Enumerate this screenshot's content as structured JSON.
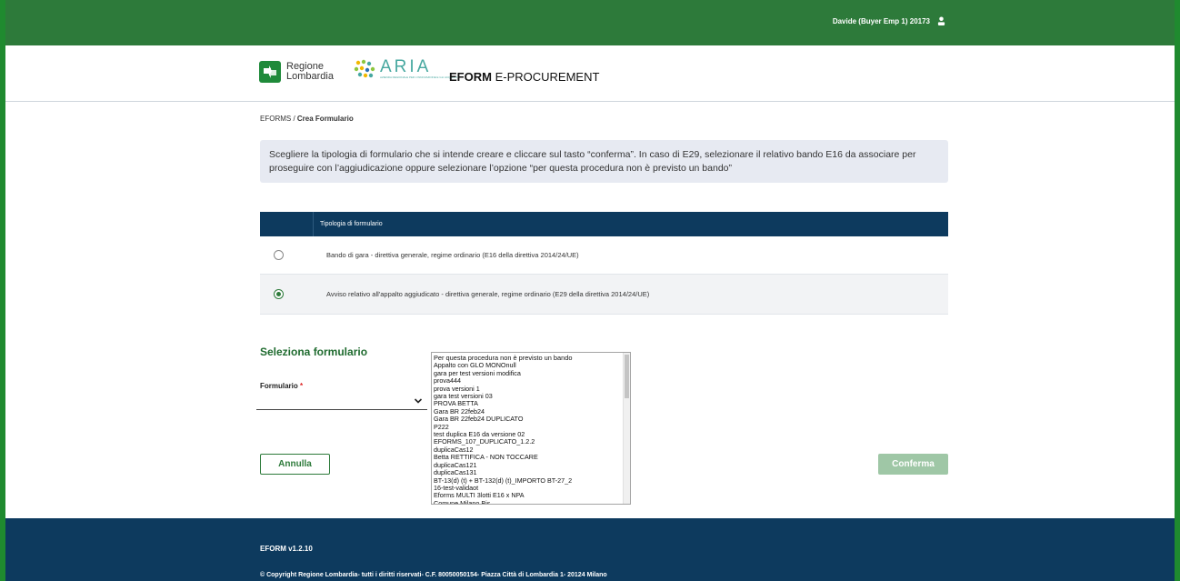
{
  "topbar": {
    "user_label": "Davide (Buyer Emp 1) 20173"
  },
  "header": {
    "rl_line1": "Regione",
    "rl_line2": "Lombardia",
    "aria_text": "ARIA",
    "aria_sub": "AZIENDA REGIONALE PER L'INNOVAZIONE E GLI ACQUISTI",
    "title_bold": "EFORM",
    "title_rest": " E-PROCUREMENT"
  },
  "breadcrumb": {
    "root": "EFORMS",
    "separator": " / ",
    "current": "Crea Formulario"
  },
  "info_text": "Scegliere la tipologia di formulario che si intende creare e cliccare sul tasto “conferma”. In caso di E29, selezionare il relativo bando E16 da associare per proseguire con l’aggiudicazione oppure selezionare l’opzione “per questa procedura non è previsto un bando”",
  "table": {
    "header": "Tipologia di formulario",
    "rows": [
      {
        "label": "Bando di gara - direttiva generale, regime ordinario (E16 della direttiva 2014/24/UE)",
        "selected": false
      },
      {
        "label": "Avviso relativo all'appalto aggiudicato - direttiva generale, regime ordinario (E29 della direttiva 2014/24/UE)",
        "selected": true
      }
    ]
  },
  "section_title": "Seleziona formulario",
  "form": {
    "label": "Formulario",
    "required_mark": "*"
  },
  "dropdown_options": [
    "Per questa procedura non è previsto un bando",
    "Appalto con GLO MONOnull",
    "gara per test versioni modifica",
    "prova444",
    "prova versioni 1",
    "gara test versioni 03",
    "PROVA BETTA",
    "Gara BR 22feb24",
    "Gara BR 22feb24 DUPLICATO",
    "P222",
    "test duplica E16 da versione 02",
    "EFORMS_107_DUPLICATO_1.2.2",
    "duplicaCas12",
    "Betta RETTIFICA - NON TOCCARE",
    "duplicaCas121",
    "duplicaCas131",
    "BT-13(d) (t) + BT-132(d) (t)_IMPORTO BT-27_2",
    "16-test-validaot",
    "Eforms MULTI 3lotti E16 x NPA",
    "Comune Milano Bis"
  ],
  "buttons": {
    "cancel": "Annulla",
    "confirm": "Conferma"
  },
  "footer": {
    "version": "EFORM v1.2.10",
    "copyright": "© Copyright Regione Lombardia- tutti i diritti riservati- C.F. 80050050154- Piazza Città di Lombardia 1- 20124 Milano"
  },
  "colors": {
    "green": "#2d7a3a",
    "navy": "#0d3a5e",
    "info_bg": "#e7eaf2",
    "confirm_disabled": "#9fc7a6"
  }
}
